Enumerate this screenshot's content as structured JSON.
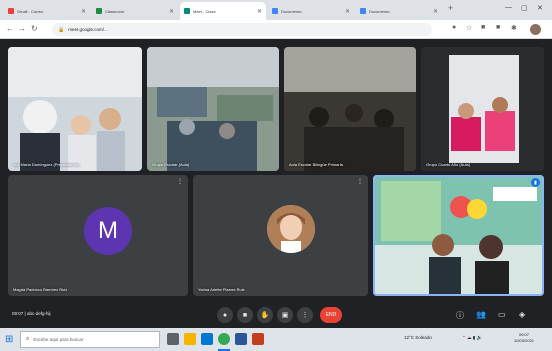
{
  "browser": {
    "tabs": [
      {
        "title": "Gmail - Correo",
        "favicon_color": "#ea4335",
        "active": false
      },
      {
        "title": "Classroom",
        "favicon_color": "#1e8e3e",
        "active": false
      },
      {
        "title": "Meet - Clase",
        "favicon_color": "#00897b",
        "active": true
      },
      {
        "title": "Documento",
        "favicon_color": "#4285f4",
        "active": false
      },
      {
        "title": "Documento",
        "favicon_color": "#4285f4",
        "active": false
      }
    ],
    "url": "meet.google.com/..."
  },
  "participants": [
    {
      "name": "Luz María Domínguez (Presentación)",
      "type": "camera"
    },
    {
      "name": "Grupo Escolar (Aula)",
      "type": "camera"
    },
    {
      "name": "Aula Escolar Bilingüe Primaria",
      "type": "camera"
    },
    {
      "name": "Grupo Cuarto Año (Aula)",
      "type": "camera"
    },
    {
      "name": "Magda Pacheco Ramírez Ruiz",
      "type": "initial",
      "initial": "M",
      "color": "#5e35b1"
    },
    {
      "name": "Yarina Arlette Pizarro Ruiz",
      "type": "photo"
    },
    {
      "name": "",
      "type": "camera",
      "speaking": true
    }
  ],
  "meeting": {
    "time": "09:07",
    "code": "abc-defg-hij"
  },
  "controls": {
    "end_label": "END"
  },
  "taskbar": {
    "search_placeholder": "Escribe aquí para buscar",
    "weather": "12°C Soleado",
    "time": "09:07",
    "date": "10/03/2021"
  },
  "colors": {
    "accent": "#1a73e8",
    "end_call": "#ea4335",
    "speaker_outline": "#8ab4f8"
  }
}
